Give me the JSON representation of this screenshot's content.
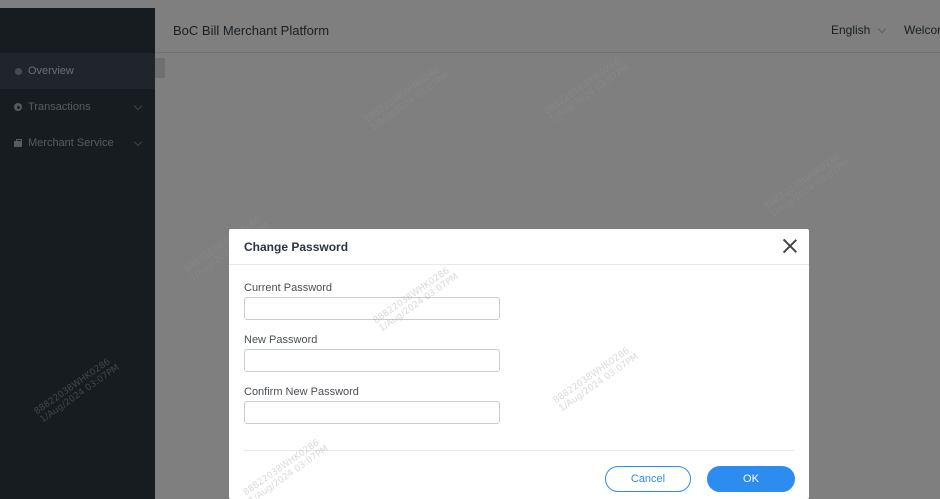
{
  "header": {
    "title": "BoC Bill Merchant Platform",
    "language": "English",
    "welcome": "Welcor"
  },
  "sidebar": {
    "items": [
      {
        "label": "Overview",
        "icon": "circle-icon",
        "active": true
      },
      {
        "label": "Transactions",
        "icon": "gear-icon",
        "has_submenu": true
      },
      {
        "label": "Merchant Service",
        "icon": "briefcase-icon",
        "has_submenu": true
      }
    ]
  },
  "modal": {
    "title": "Change Password",
    "fields": [
      {
        "label": "Current Password",
        "value": "",
        "placeholder": ""
      },
      {
        "label": "New Password",
        "value": "",
        "placeholder": ""
      },
      {
        "label": "Confirm New Password",
        "value": "",
        "placeholder": ""
      }
    ],
    "cancel_label": "Cancel",
    "ok_label": "OK"
  },
  "watermark": {
    "line1": "88822038WHK0286",
    "line2": "1/Aug/2024 03:07PM"
  },
  "colors": {
    "sidebar_bg": "#2f3943",
    "sidebar_active_bg": "#3f4a55",
    "primary": "#2d8cf0",
    "overlay": "rgba(0,0,0,0.5)"
  }
}
